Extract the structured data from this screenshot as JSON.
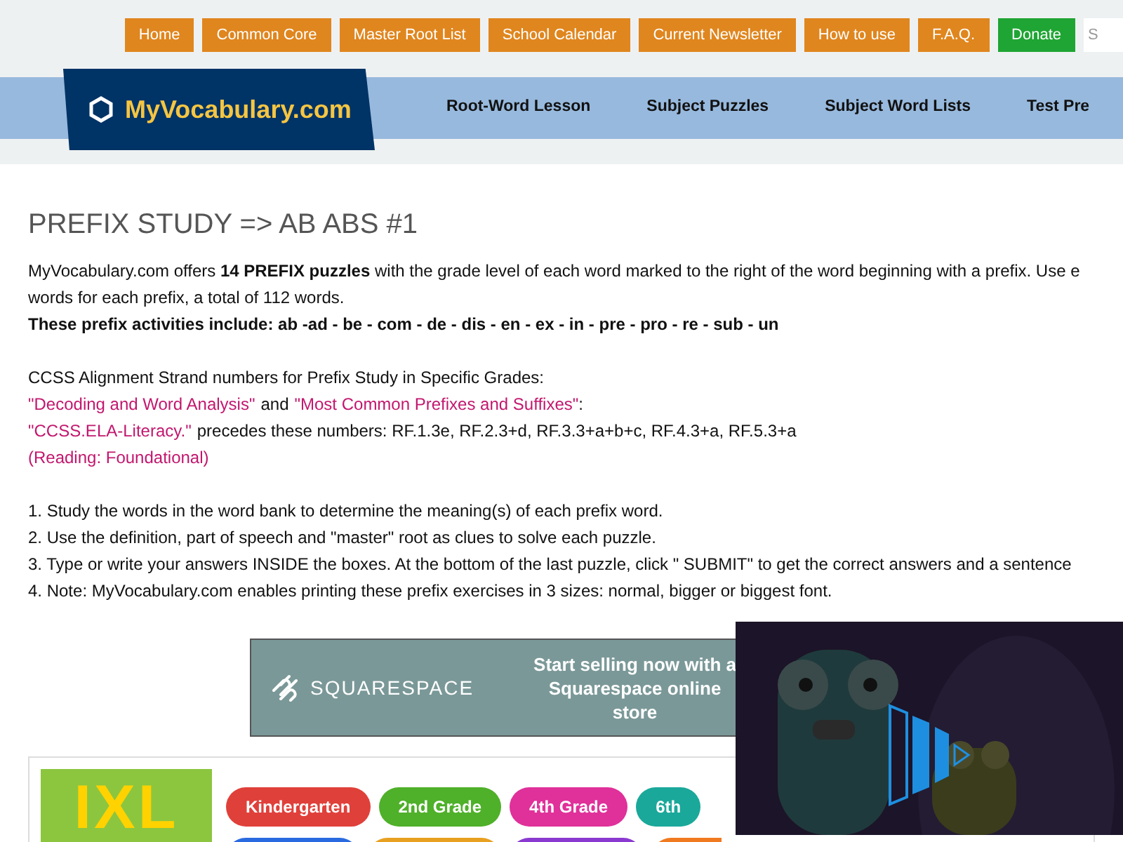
{
  "top_links": [
    {
      "label": "Home",
      "kind": "link"
    },
    {
      "label": "Common Core",
      "kind": "link"
    },
    {
      "label": "Master Root List",
      "kind": "link"
    },
    {
      "label": "School Calendar",
      "kind": "link"
    },
    {
      "label": "Current Newsletter",
      "kind": "link"
    },
    {
      "label": "How to use",
      "kind": "link"
    },
    {
      "label": "F.A.Q.",
      "kind": "link"
    },
    {
      "label": "Donate",
      "kind": "donate"
    }
  ],
  "search": {
    "placeholder": "S"
  },
  "logo": {
    "text": "MyVocabulary.com"
  },
  "nav": [
    "Root-Word Lesson",
    "Subject Puzzles",
    "Subject Word Lists",
    "Test Pre"
  ],
  "title": "PREFIX STUDY => AB ABS #1",
  "intro": [
    "MyVocabulary.com offers **14 PREFIX puzzles** with the grade level of each word marked to the right of the word beginning with a prefix. Use e",
    "words for each prefix, a total of 112 words."
  ],
  "activities": "These prefix activities include: ab -ad - be - com - de - dis - en - ex - in - pre - pro - re - sub - un",
  "ccss": {
    "heading": "CCSS Alignment Strand numbers for Prefix Study in Specific Grades:",
    "link_1": "\"Decoding and Word Analysis\"",
    "joiner": "and",
    "link_2": "\"Most Common Prefixes and Suffixes\"",
    "colon": ":",
    "link_3": "\"CCSS.ELA-Literacy.\"",
    "numbers": "precedes these numbers: RF.1.3e, RF.2.3+d, RF.3.3+a+b+c, RF.4.3+a, RF.5.3+a",
    "link_4": "(Reading: Foundational)"
  },
  "steps": [
    "1. Study the words in the word bank to determine the meaning(s) of each prefix word.",
    "2. Use the definition, part of speech and \"master\" root as clues to solve each puzzle.",
    "3. Type or write your answers INSIDE the boxes. At the bottom of the last puzzle, click \" SUBMIT\" to get the correct answers and a sentence",
    "4. Note: MyVocabulary.com enables printing these prefix exercises in 3 sizes: normal, bigger or biggest font."
  ],
  "ad": {
    "brand": "SQUARESPACE",
    "text": "Start selling now with a Squarespace online store"
  },
  "ixl": {
    "logo": "IXL",
    "grades": [
      {
        "label": "Kindergarten",
        "color": "#e0403a"
      },
      {
        "label": "2nd Grade",
        "color": "#4fb02a"
      },
      {
        "label": "4th Grade",
        "color": "#e0309a"
      },
      {
        "label": "6th",
        "color": "#1aa89a"
      }
    ],
    "more": [
      {
        "color": "#2a6ae0"
      },
      {
        "color": "#e8a020"
      },
      {
        "color": "#8a3ad0"
      },
      {
        "color": "#f07a20"
      }
    ]
  }
}
